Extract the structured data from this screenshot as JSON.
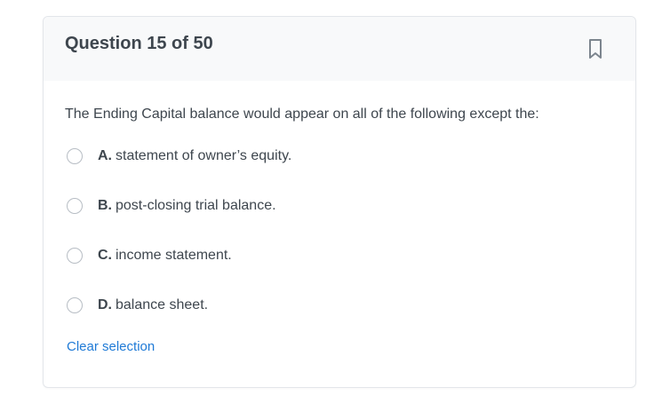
{
  "question": {
    "title": "Question 15 of 50",
    "prompt": "The Ending Capital balance would appear on all of the following except the:",
    "options": [
      {
        "letter": "A.",
        "text": "statement of owner’s equity."
      },
      {
        "letter": "B.",
        "text": "post-closing trial balance."
      },
      {
        "letter": "C.",
        "text": "income statement."
      },
      {
        "letter": "D.",
        "text": "balance sheet."
      }
    ],
    "clear_label": "Clear selection",
    "bookmark_icon": "bookmark-icon"
  },
  "colors": {
    "header_bg": "#f8f9fa",
    "text": "#3e464e",
    "link": "#1f7ad6",
    "radio_border": "#b7bdc4"
  }
}
